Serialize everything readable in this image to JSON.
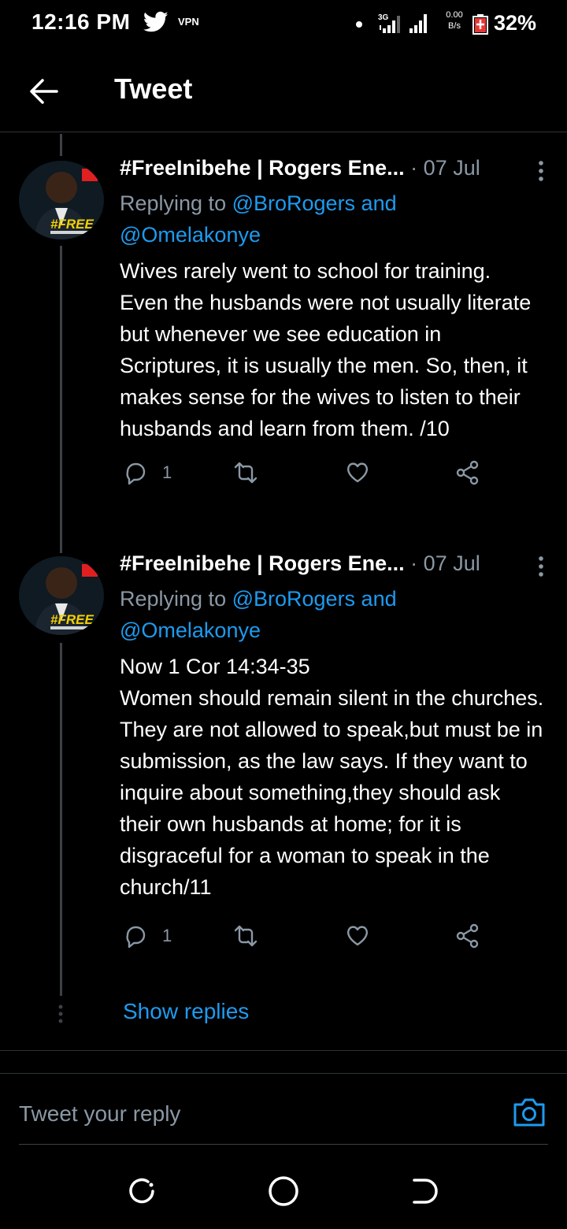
{
  "status_bar": {
    "time": "12:16 PM",
    "vpn": "VPN",
    "network": "3G",
    "speed_value": "0.00",
    "speed_unit": "B/s",
    "battery": "32%"
  },
  "header": {
    "title": "Tweet"
  },
  "tweets": [
    {
      "author": "#FreeInibehe | Rogers Ene...",
      "date": "07 Jul",
      "replying_prefix": "Replying to ",
      "replying_mention_1": "@BroRogers and",
      "replying_mention_2": "@Omelakonye",
      "text": "Wives rarely went to school for training. Even the husbands were not usually literate but whenever we see education in Scriptures, it is usually the men. So, then, it makes sense for the wives to listen to their husbands and learn from them. /10",
      "reply_count": "1"
    },
    {
      "author": "#FreeInibehe | Rogers Ene...",
      "date": "07 Jul",
      "replying_prefix": "Replying to ",
      "replying_mention_1": "@BroRogers and",
      "replying_mention_2": "@Omelakonye",
      "text_line_1": "Now 1 Cor 14:34-35",
      "text": "Women should remain silent in the churches. They are not allowed to speak,but must be in submission, as the law says. If they want to inquire about something,they should ask their own husbands at home; for it is disgraceful for a woman to speak in the church/11",
      "reply_count": "1"
    }
  ],
  "show_replies": "Show replies",
  "reply_box": {
    "placeholder": "Tweet your reply"
  },
  "avatar_badge": "#FREE",
  "colors": {
    "background": "#000000",
    "accent": "#1d9bf0",
    "muted": "#8b98a5"
  }
}
